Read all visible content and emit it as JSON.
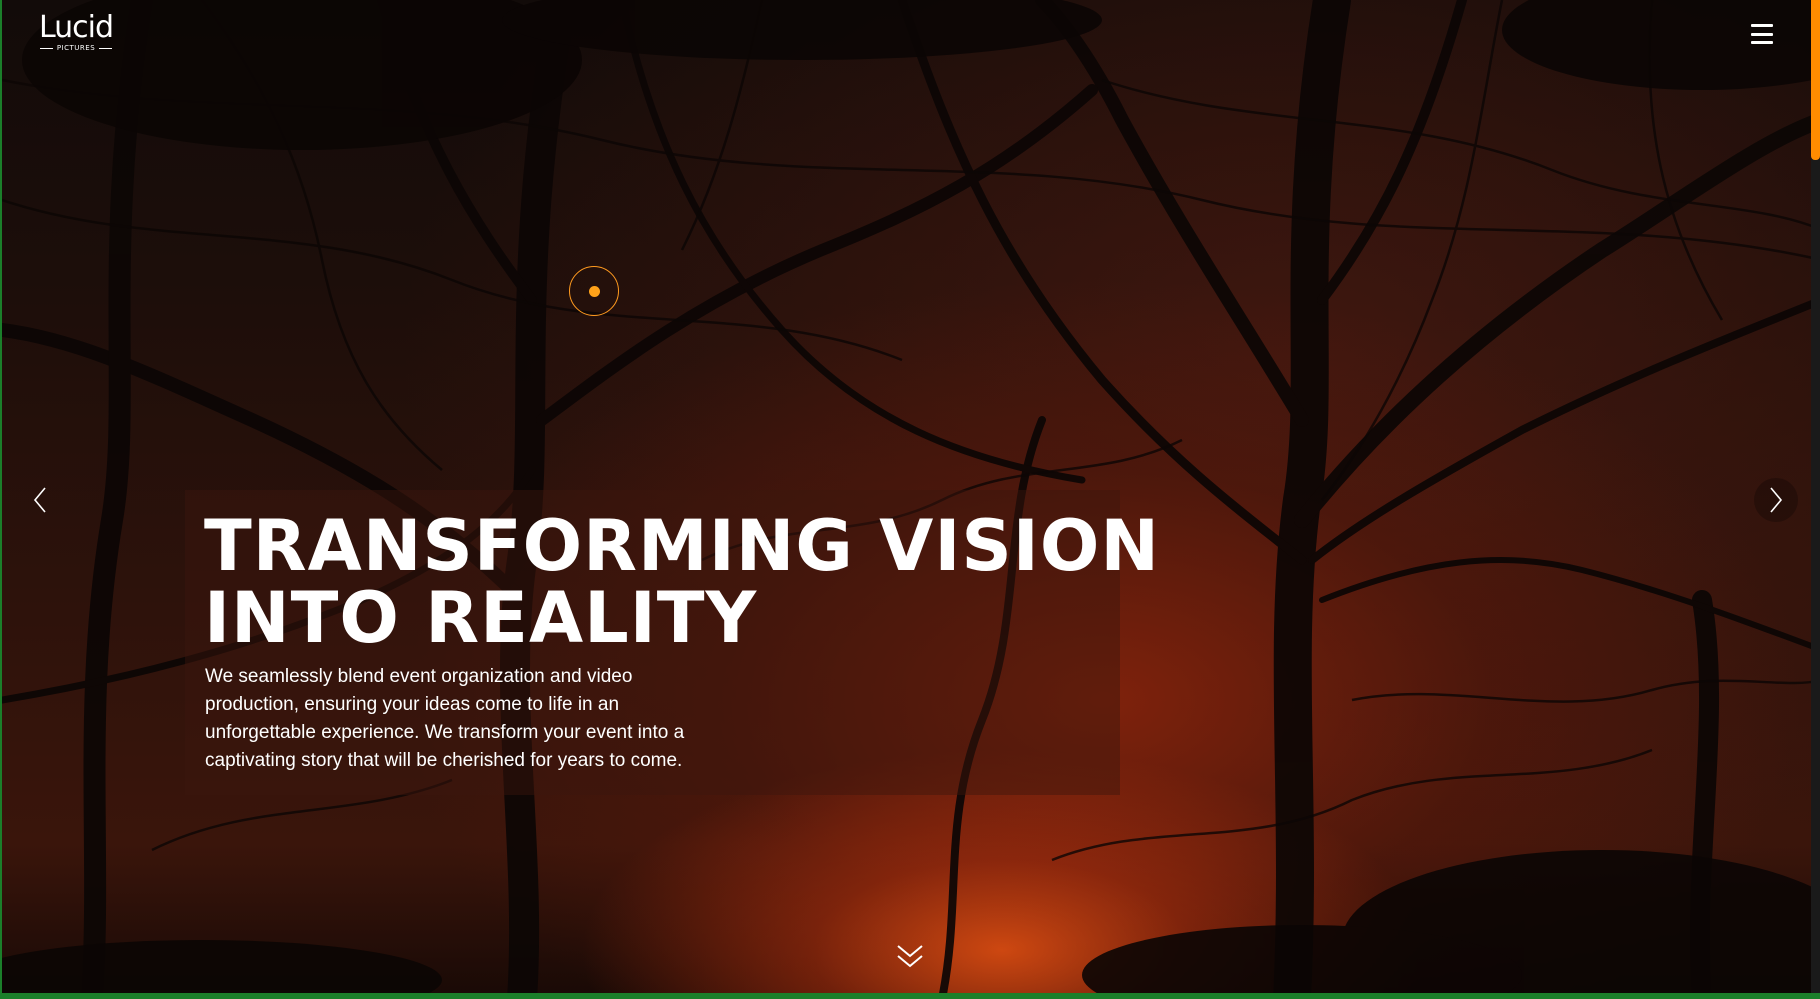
{
  "brand": {
    "name": "Lucid",
    "tagline": "PICTURES"
  },
  "header": {
    "menu_icon": "hamburger-menu-icon"
  },
  "hero": {
    "title_line_1": "TRANSFORMING VISION",
    "title_line_2": "INTO REALITY",
    "description": "We seamlessly blend event organization and video production, ensuring your ideas come to life in an unforgettable experience. We transform your event into a captivating story that will be cherished for years to come."
  },
  "slider": {
    "prev_icon": "chevron-left-icon",
    "next_icon": "chevron-right-icon",
    "scroll_icon": "double-chevron-down-icon"
  },
  "colors": {
    "accent": "#ff9a1f",
    "text": "#ffffff",
    "scrollbar_thumb": "#ff8c00"
  }
}
